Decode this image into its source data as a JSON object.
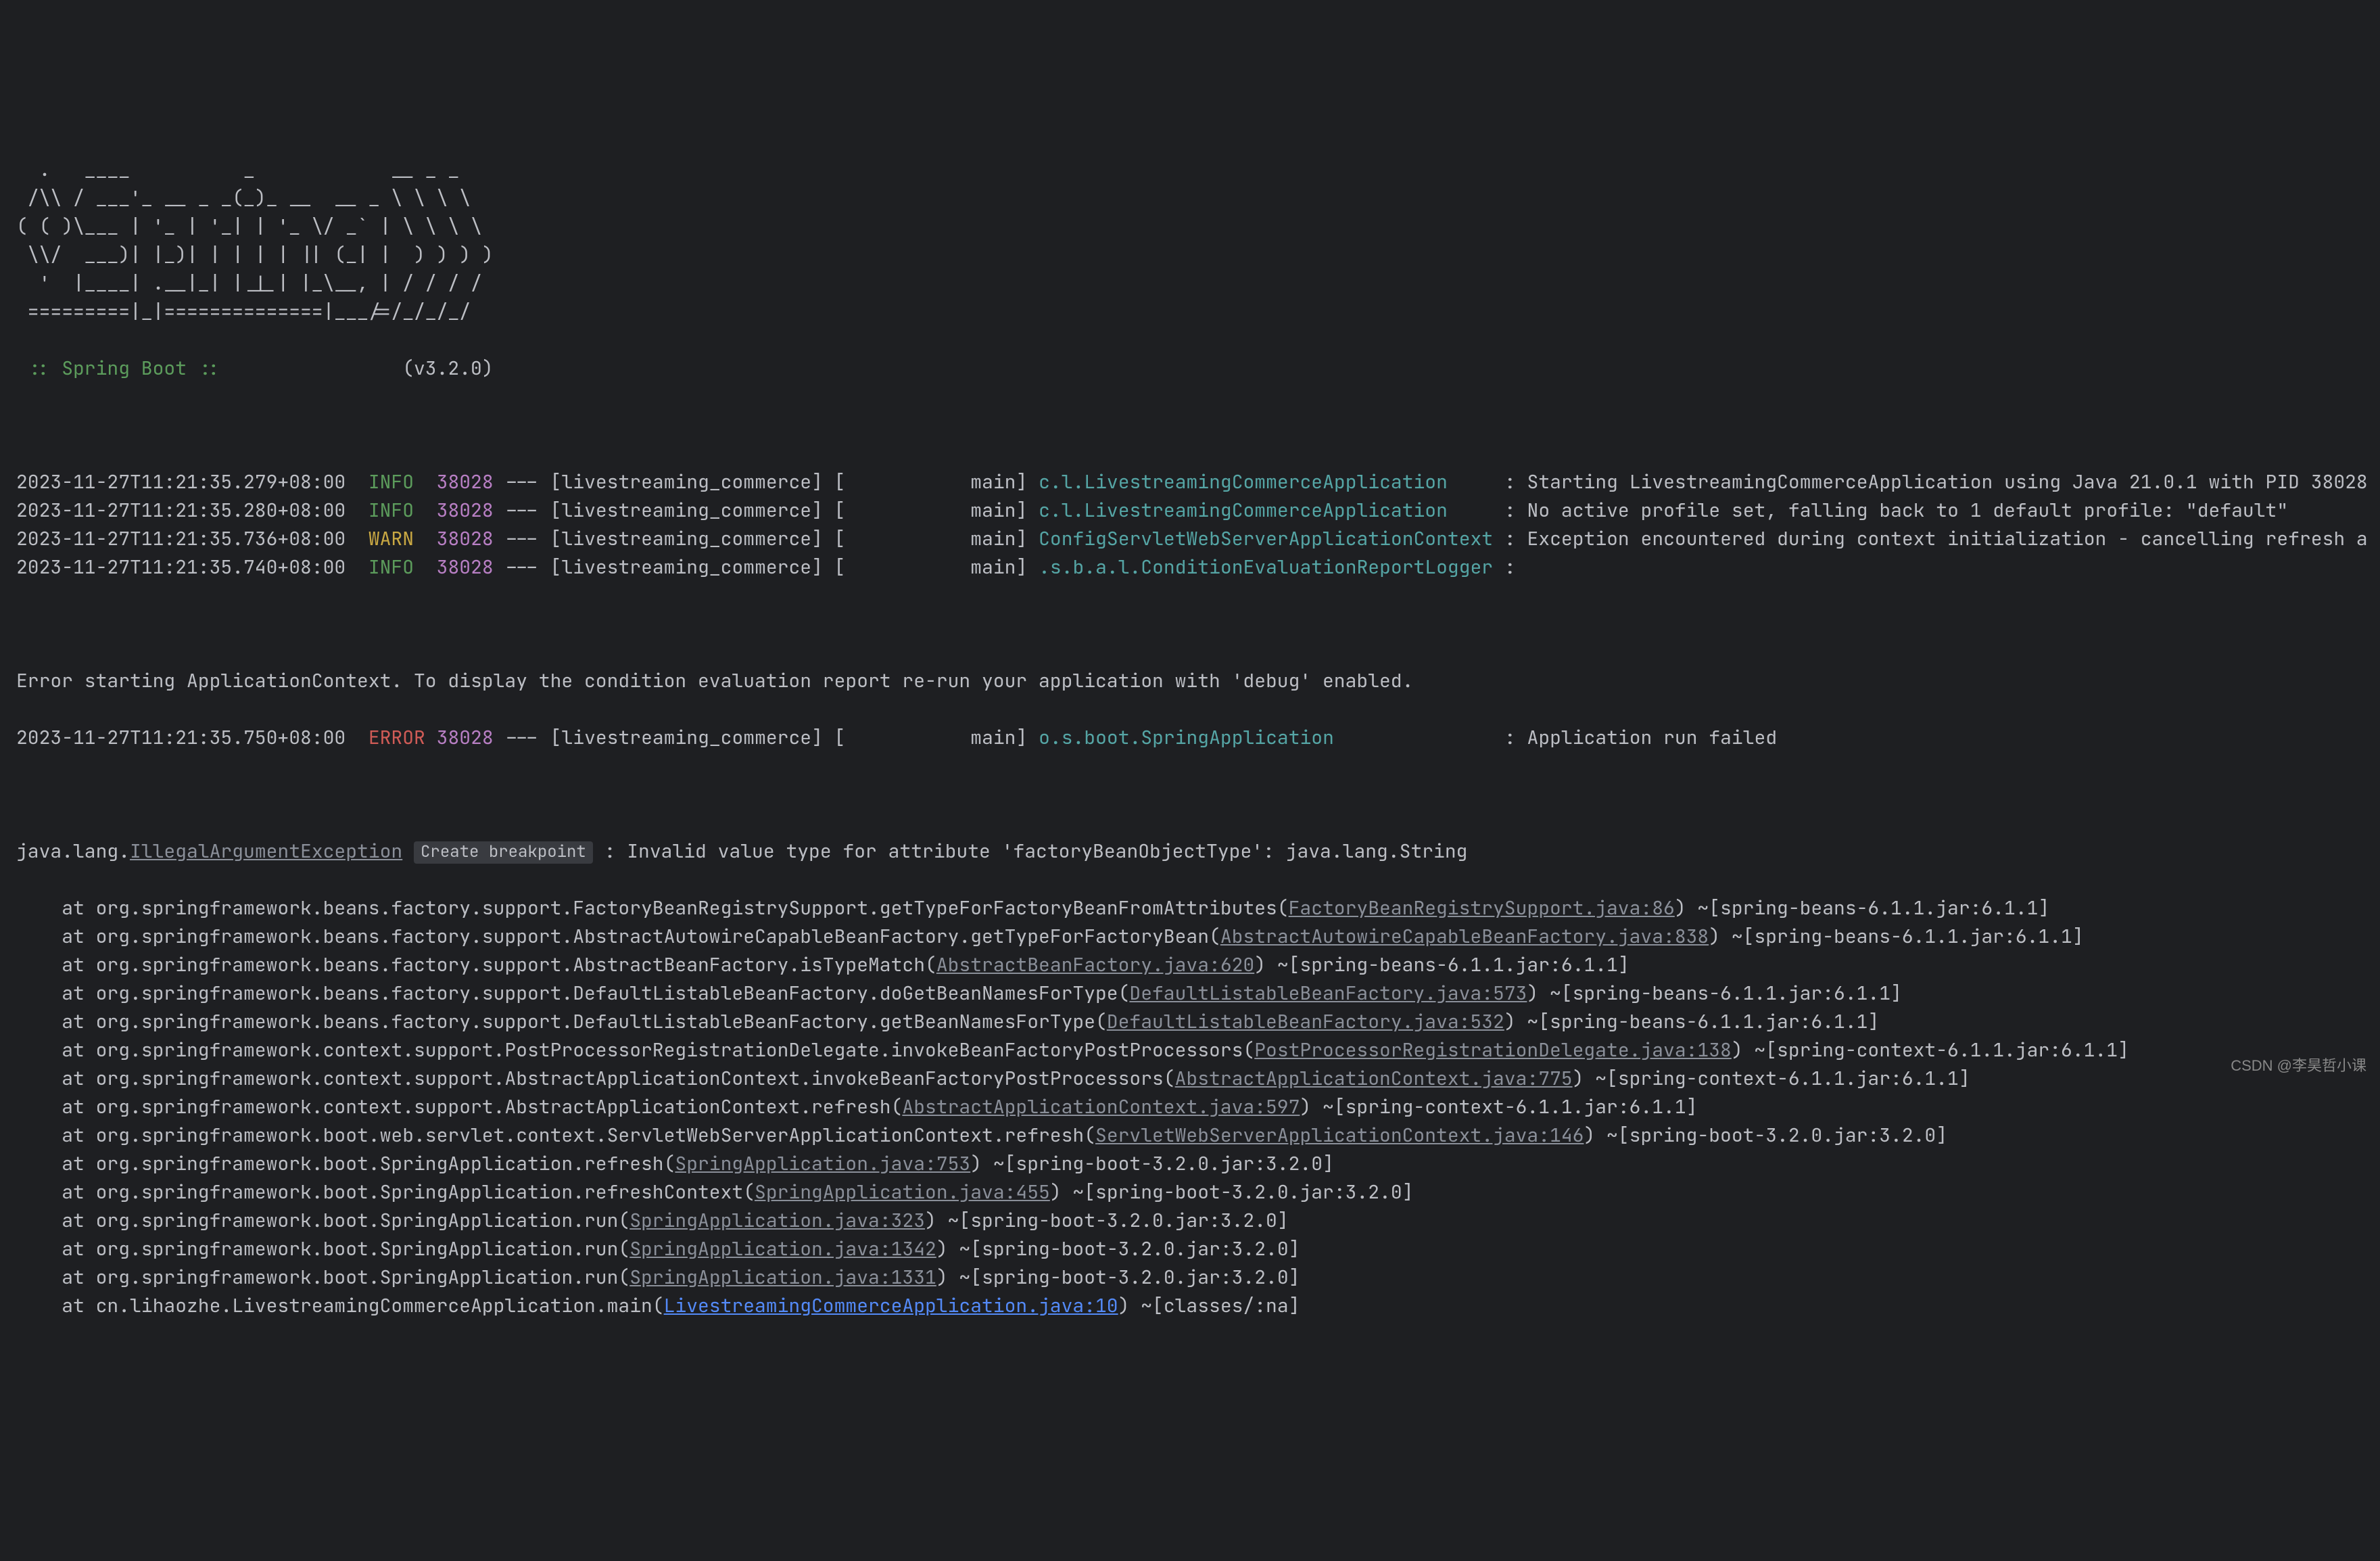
{
  "banner": "  .   ____          _            __ _ _\n /\\\\ / ___'_ __ _ _(_)_ __  __ _ \\ \\ \\ \\\n( ( )\\___ | '_ | '_| | '_ \\/ _` | \\ \\ \\ \\\n \\\\/  ___)| |_)| | | | | || (_| |  ) ) ) )\n  '  |____| .__|_| |_|_| |_\\__, | / / / /\n =========|_|==============|___/=/_/_/_/",
  "spring_label": " :: Spring Boot :: ",
  "version": "               (v3.2.0)",
  "log_lines": [
    {
      "ts": "2023-11-27T11:21:35.279+08:00",
      "level": "INFO",
      "level_class": "info",
      "pid": "38028",
      "thread": "[livestreaming_commerce] [           main]",
      "logger": "c.l.LivestreamingCommerceApplication    ",
      "msg": ": Starting LivestreamingCommerceApplication using Java 21.0.1 with PID 38028"
    },
    {
      "ts": "2023-11-27T11:21:35.280+08:00",
      "level": "INFO",
      "level_class": "info",
      "pid": "38028",
      "thread": "[livestreaming_commerce] [           main]",
      "logger": "c.l.LivestreamingCommerceApplication    ",
      "msg": ": No active profile set, falling back to 1 default profile: \"default\""
    },
    {
      "ts": "2023-11-27T11:21:35.736+08:00",
      "level": "WARN",
      "level_class": "warn",
      "pid": "38028",
      "thread": "[livestreaming_commerce] [           main]",
      "logger": "ConfigServletWebServerApplicationContext",
      "msg": ": Exception encountered during context initialization - cancelling refresh a"
    },
    {
      "ts": "2023-11-27T11:21:35.740+08:00",
      "level": "INFO",
      "level_class": "info",
      "pid": "38028",
      "thread": "[livestreaming_commerce] [           main]",
      "logger": ".s.b.a.l.ConditionEvaluationReportLogger",
      "msg": ": "
    }
  ],
  "error_prelude": "Error starting ApplicationContext. To display the condition evaluation report re-run your application with 'debug' enabled.",
  "error_line": {
    "ts": "2023-11-27T11:21:35.750+08:00",
    "level": "ERROR",
    "level_class": "error",
    "pid": "38028",
    "thread": "[livestreaming_commerce] [           main]",
    "logger": "o.s.boot.SpringApplication              ",
    "msg": ": Application run failed"
  },
  "exception_prefix": "java.lang.",
  "exception_class": "IllegalArgumentException",
  "breakpoint_label": "Create breakpoint",
  "exception_msg": " : Invalid value type for attribute 'factoryBeanObjectType': java.lang.String",
  "stack": [
    {
      "prefix": "    at org.springframework.beans.factory.support.FactoryBeanRegistrySupport.getTypeForFactoryBeanFromAttributes(",
      "link": "FactoryBeanRegistrySupport.java:86",
      "link_class": "link",
      "suffix": ") ~[spring-beans-6.1.1.jar:6.1.1]"
    },
    {
      "prefix": "    at org.springframework.beans.factory.support.AbstractAutowireCapableBeanFactory.getTypeForFactoryBean(",
      "link": "AbstractAutowireCapableBeanFactory.java:838",
      "link_class": "link",
      "suffix": ") ~[spring-beans-6.1.1.jar:6.1.1]"
    },
    {
      "prefix": "    at org.springframework.beans.factory.support.AbstractBeanFactory.isTypeMatch(",
      "link": "AbstractBeanFactory.java:620",
      "link_class": "link",
      "suffix": ") ~[spring-beans-6.1.1.jar:6.1.1]"
    },
    {
      "prefix": "    at org.springframework.beans.factory.support.DefaultListableBeanFactory.doGetBeanNamesForType(",
      "link": "DefaultListableBeanFactory.java:573",
      "link_class": "link",
      "suffix": ") ~[spring-beans-6.1.1.jar:6.1.1]"
    },
    {
      "prefix": "    at org.springframework.beans.factory.support.DefaultListableBeanFactory.getBeanNamesForType(",
      "link": "DefaultListableBeanFactory.java:532",
      "link_class": "link",
      "suffix": ") ~[spring-beans-6.1.1.jar:6.1.1]"
    },
    {
      "prefix": "    at org.springframework.context.support.PostProcessorRegistrationDelegate.invokeBeanFactoryPostProcessors(",
      "link": "PostProcessorRegistrationDelegate.java:138",
      "link_class": "link",
      "suffix": ") ~[spring-context-6.1.1.jar:6.1.1]"
    },
    {
      "prefix": "    at org.springframework.context.support.AbstractApplicationContext.invokeBeanFactoryPostProcessors(",
      "link": "AbstractApplicationContext.java:775",
      "link_class": "link",
      "suffix": ") ~[spring-context-6.1.1.jar:6.1.1]"
    },
    {
      "prefix": "    at org.springframework.context.support.AbstractApplicationContext.refresh(",
      "link": "AbstractApplicationContext.java:597",
      "link_class": "link",
      "suffix": ") ~[spring-context-6.1.1.jar:6.1.1]"
    },
    {
      "prefix": "    at org.springframework.boot.web.servlet.context.ServletWebServerApplicationContext.refresh(",
      "link": "ServletWebServerApplicationContext.java:146",
      "link_class": "link",
      "suffix": ") ~[spring-boot-3.2.0.jar:3.2.0]"
    },
    {
      "prefix": "    at org.springframework.boot.SpringApplication.refresh(",
      "link": "SpringApplication.java:753",
      "link_class": "link",
      "suffix": ") ~[spring-boot-3.2.0.jar:3.2.0]"
    },
    {
      "prefix": "    at org.springframework.boot.SpringApplication.refreshContext(",
      "link": "SpringApplication.java:455",
      "link_class": "link",
      "suffix": ") ~[spring-boot-3.2.0.jar:3.2.0]"
    },
    {
      "prefix": "    at org.springframework.boot.SpringApplication.run(",
      "link": "SpringApplication.java:323",
      "link_class": "link",
      "suffix": ") ~[spring-boot-3.2.0.jar:3.2.0]"
    },
    {
      "prefix": "    at org.springframework.boot.SpringApplication.run(",
      "link": "SpringApplication.java:1342",
      "link_class": "link",
      "suffix": ") ~[spring-boot-3.2.0.jar:3.2.0]"
    },
    {
      "prefix": "    at org.springframework.boot.SpringApplication.run(",
      "link": "SpringApplication.java:1331",
      "link_class": "link",
      "suffix": ") ~[spring-boot-3.2.0.jar:3.2.0]"
    },
    {
      "prefix": "    at cn.lihaozhe.LivestreamingCommerceApplication.main(",
      "link": "LivestreamingCommerceApplication.java:10",
      "link_class": "link-blue",
      "suffix": ") ~[classes/:na]"
    }
  ],
  "watermark": "CSDN @李昊哲小课"
}
